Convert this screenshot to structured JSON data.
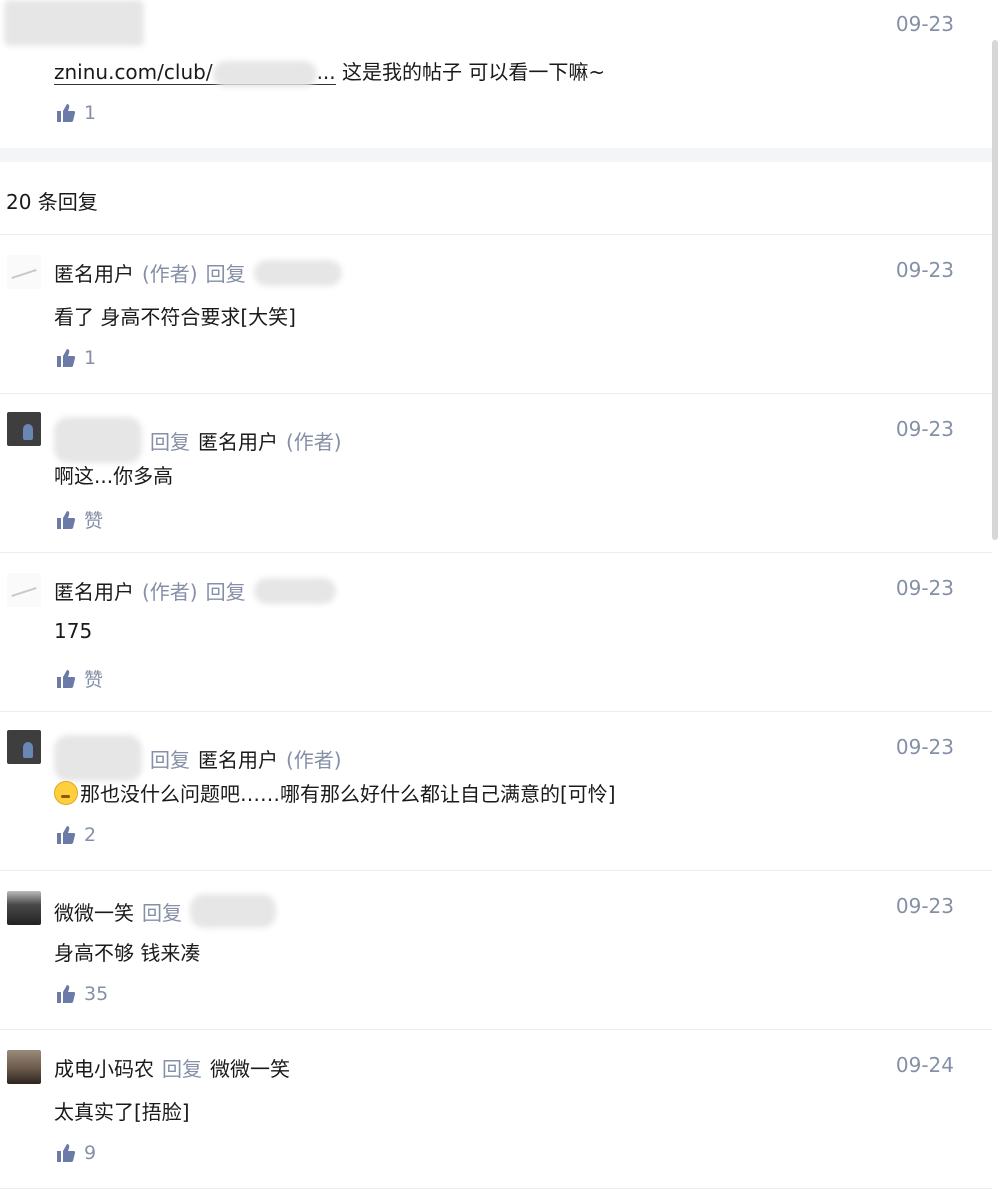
{
  "top_comment": {
    "date": "09-23",
    "link_text": "zninu.com/club/",
    "ellipsis": "...",
    "text": "这是我的帖子 可以看一下嘛~",
    "likes": "1"
  },
  "reply_count": "20 条回复",
  "comments": [
    {
      "name": "匿名用户",
      "author_tag": "(作者)",
      "reply_word": "回复",
      "reply_to": "",
      "date": "09-23",
      "text": "看了 身高不符合要求[大笑]",
      "likes": "1"
    },
    {
      "name": "",
      "author_tag": "(作者)",
      "reply_word": "回复",
      "reply_to": "匿名用户",
      "date": "09-23",
      "text": "啊这...你多高",
      "likes": "赞"
    },
    {
      "name": "匿名用户",
      "author_tag": "(作者)",
      "reply_word": "回复",
      "reply_to": "",
      "date": "09-23",
      "text": "175",
      "likes": "赞"
    },
    {
      "name": "",
      "author_tag": "(作者)",
      "reply_word": "回复",
      "reply_to": "匿名用户",
      "date": "09-23",
      "text": "那也没什么问题吧……哪有那么好什么都让自己满意的[可怜]",
      "likes": "2"
    },
    {
      "name": "微微一笑",
      "reply_word": "回复",
      "reply_to": "",
      "date": "09-23",
      "text": "身高不够 钱来凑",
      "likes": "35"
    },
    {
      "name": "成电小码农",
      "reply_word": "回复",
      "reply_to": "微微一笑",
      "date": "09-24",
      "text": "太真实了[捂脸]",
      "likes": "9"
    }
  ]
}
